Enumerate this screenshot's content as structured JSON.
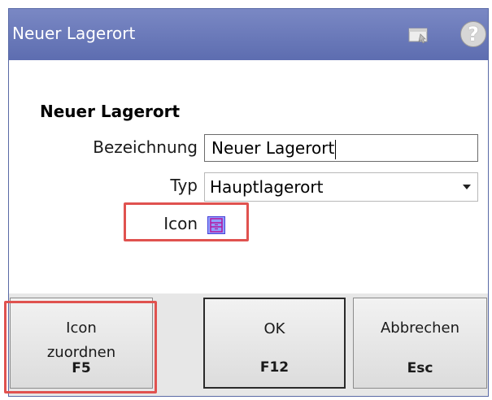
{
  "window": {
    "title": "Neuer Lagerort",
    "help_glyph": "?"
  },
  "form": {
    "section_title": "Neuer Lagerort",
    "bezeichnung_label": "Bezeichnung",
    "bezeichnung_value": "Neuer Lagerort",
    "typ_label": "Typ",
    "typ_value": "Hauptlagerort",
    "icon_label": "Icon"
  },
  "buttons": {
    "icon_line1": "Icon",
    "icon_line2": "zuordnen",
    "icon_key": "F5",
    "ok_label": "OK",
    "ok_key": "F12",
    "cancel_label": "Abbrechen",
    "cancel_key": "Esc"
  },
  "colors": {
    "titlebar": "#6676ba",
    "highlight": "#e0524f",
    "icon_fill": "#8fa0ff"
  },
  "icons": [
    "window-restore-icon",
    "help-icon",
    "storage-location-icon",
    "dropdown-arrow-icon"
  ]
}
